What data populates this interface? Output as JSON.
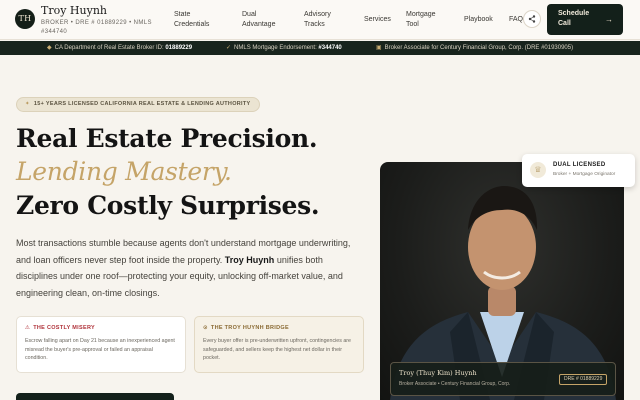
{
  "header": {
    "logo_initials": "TH",
    "name": "Troy Huynh",
    "subtitle": "BROKER • DRE # 01889229 • NMLS #344740",
    "nav": [
      "State Credentials",
      "Dual Advantage",
      "Advisory Tracks",
      "Services",
      "Mortgage Tool",
      "Playbook",
      "FAQ"
    ],
    "share_icon": "share-icon",
    "cta_label": "Schedule Call",
    "cta_arrow": "→"
  },
  "license_bar": {
    "item1_text": "CA Department of Real Estate Broker ID: ",
    "item1_value": "01889229",
    "item2_text": "NMLS Mortgage Endorsement: ",
    "item2_value": "#344740",
    "item3_text": "Broker Associate for Century Financial Group, Corp. (DRE #01930905)"
  },
  "hero": {
    "badge": "15+ YEARS LICENSED CALIFORNIA REAL ESTATE & LENDING AUTHORITY",
    "line1": "Real Estate Precision.",
    "line2": "Lending Mastery.",
    "line3": "Zero Costly Surprises.",
    "lead_a": "Most transactions stumble because agents don't understand mortgage underwriting, and loan officers never step foot inside the property. ",
    "lead_name": "Troy Huynh",
    "lead_b": " unifies both disciplines under one roof—protecting your equity, unlocking off-market value, and engineering clean, on-time closings.",
    "card1_title": "THE COSTLY MISERY",
    "card1_text": "Escrow falling apart on Day 21 because an inexperienced agent misread the buyer's pre-approval or failed an appraisal condition.",
    "card2_title": "THE TROY HUYNH BRIDGE",
    "card2_text": "Every buyer offer is pre-underwritten upfront, contingencies are safeguarded, and sellers keep the highest net dollar in their pocket."
  },
  "photo": {
    "dual_title": "DUAL LICENSED",
    "dual_sub": "Broker + Mortgage Originator",
    "caption_name": "Troy (Thuy Kim) Huynh",
    "caption_role": "Broker Associate • Century Financial Group, Corp.",
    "caption_dre": "DRE # 01889229"
  }
}
